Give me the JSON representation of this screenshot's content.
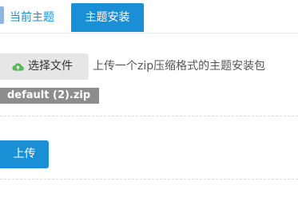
{
  "tabs": {
    "current_theme": "当前主题",
    "theme_install": "主题安装"
  },
  "upload_form": {
    "choose_file_label": "选择文件",
    "hint": "上传一个zip压缩格式的主题安装包",
    "selected_file": "default (2).zip",
    "submit_label": "上传"
  },
  "icons": {
    "choose_file": "cloud-upload-icon"
  },
  "colors": {
    "primary": "#1a8fd6",
    "file_tag_bg": "#8d8d8d",
    "upload_icon": "#5cb85c"
  }
}
